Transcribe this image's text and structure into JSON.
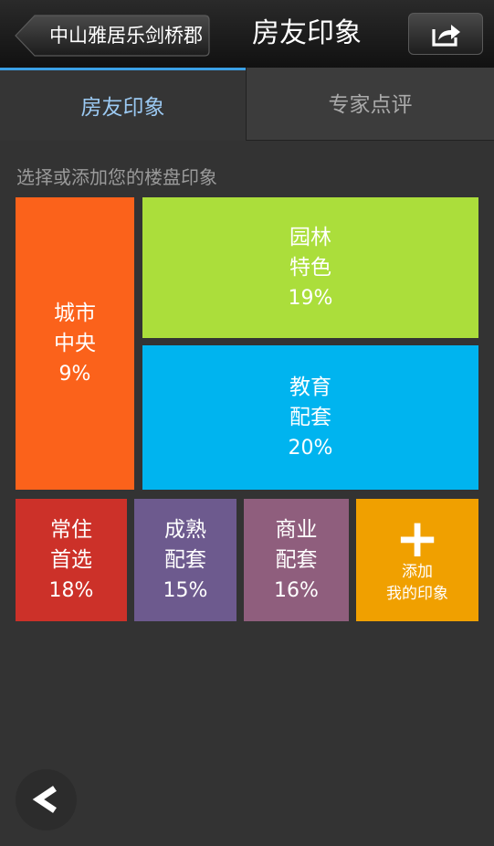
{
  "header": {
    "back_label": "中山雅居乐剑桥郡",
    "title": "房友印象",
    "share_icon": "share-icon"
  },
  "tabs": [
    {
      "label": "房友印象",
      "active": true
    },
    {
      "label": "专家点评",
      "active": false
    }
  ],
  "hint": "选择或添加您的楼盘印象",
  "tiles": [
    {
      "line1": "城市",
      "line2": "中央",
      "percent": "9%",
      "color": "#fb621b"
    },
    {
      "line1": "园林",
      "line2": "特色",
      "percent": "19%",
      "color": "#abde3b"
    },
    {
      "line1": "教育",
      "line2": "配套",
      "percent": "20%",
      "color": "#00b4ef"
    },
    {
      "line1": "常住",
      "line2": "首选",
      "percent": "18%",
      "color": "#cc3129"
    },
    {
      "line1": "成熟",
      "line2": "配套",
      "percent": "15%",
      "color": "#6d5a8e"
    },
    {
      "line1": "商业",
      "line2": "配套",
      "percent": "16%",
      "color": "#8f5e7d"
    }
  ],
  "add_tile": {
    "line1": "添加",
    "line2": "我的印象",
    "color": "#f0a000"
  }
}
